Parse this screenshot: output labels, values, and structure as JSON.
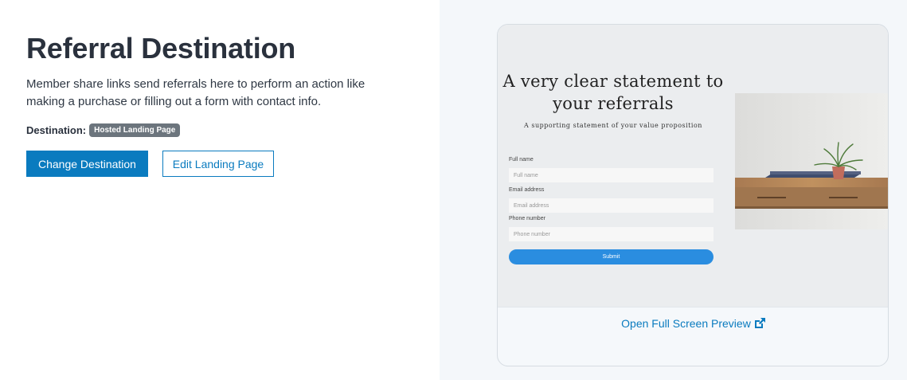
{
  "page": {
    "title": "Referral Destination",
    "description": "Member share links send referrals here to perform an action like making a purchase or filling out a form with contact info.",
    "destination_label": "Destination:",
    "destination_badge": "Hosted Landing Page",
    "change_button": "Change Destination",
    "edit_button": "Edit Landing Page"
  },
  "preview": {
    "title": "A very clear statement to your referrals",
    "subtitle": "A supporting statement of your value proposition",
    "fields": [
      {
        "label": "Full name",
        "placeholder": "Full name"
      },
      {
        "label": "Email address",
        "placeholder": "Email address"
      },
      {
        "label": "Phone number",
        "placeholder": "Phone number"
      }
    ],
    "submit": "Submit",
    "footer_link": "Open Full Screen Preview"
  },
  "colors": {
    "accent": "#0a7bbf",
    "badge": "#6c757d",
    "submit": "#2a8de0",
    "preview_bg": "#ebedef"
  },
  "icons": {
    "external": "external-link-icon"
  }
}
